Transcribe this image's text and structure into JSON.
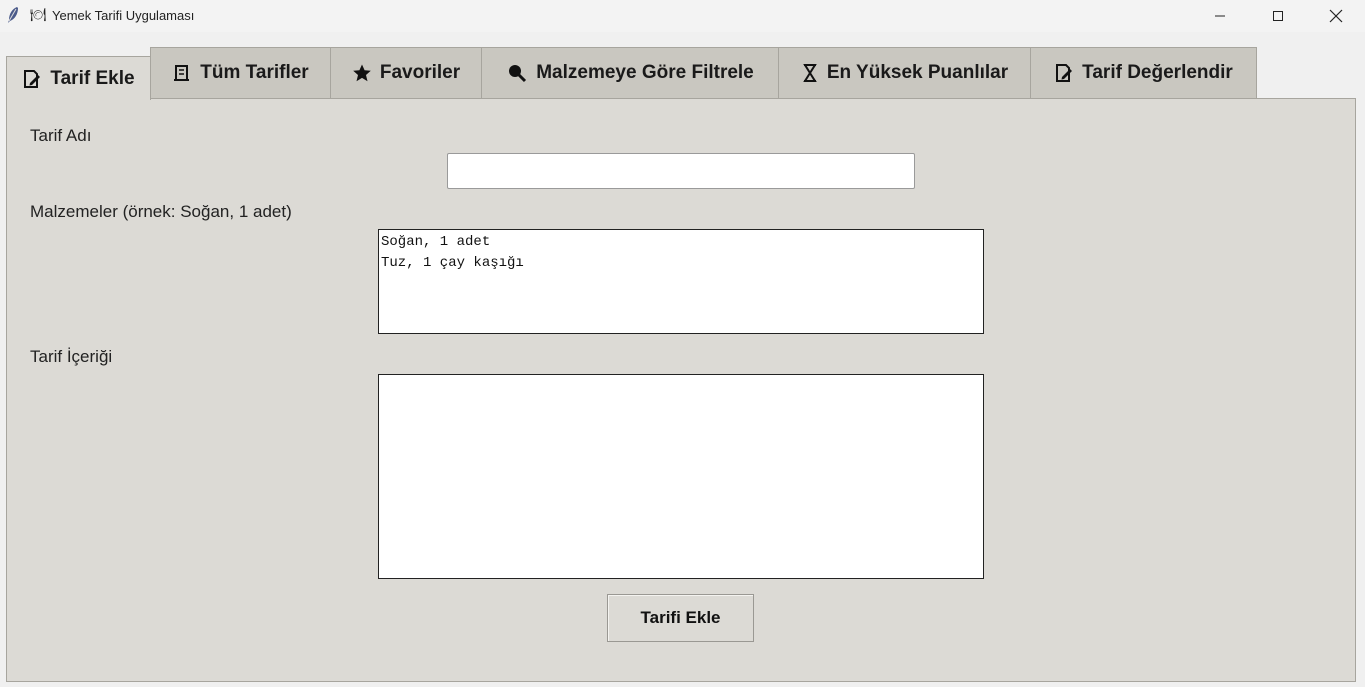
{
  "window": {
    "title_emoji": "🍽",
    "title": "Yemek Tarifi Uygulaması",
    "icons": {
      "app": "feather-icon",
      "minimize": "minimize-icon",
      "maximize": "maximize-icon",
      "close": "close-icon"
    }
  },
  "tabs": [
    {
      "label": "Tarif Ekle",
      "icon": "edit-document-icon",
      "active": true
    },
    {
      "label": "Tüm Tarifler",
      "icon": "scroll-icon",
      "active": false
    },
    {
      "label": "Favoriler",
      "icon": "star-icon",
      "active": false
    },
    {
      "label": "Malzemeye Göre Filtrele",
      "icon": "magnifier-icon",
      "active": false
    },
    {
      "label": "En Yüksek Puanlılar",
      "icon": "hourglass-icon",
      "active": false
    },
    {
      "label": "Tarif Değerlendir",
      "icon": "edit-document-icon",
      "active": false
    }
  ],
  "form": {
    "name_label": "Tarif Adı",
    "name_value": "",
    "ingredients_label": "Malzemeler (örnek: Soğan, 1 adet)",
    "ingredients_value": "Soğan, 1 adet\nTuz, 1 çay kaşığı",
    "content_label": "Tarif İçeriği",
    "content_value": "",
    "submit_label": "Tarifi Ekle"
  },
  "colors": {
    "panel": "#dcdad5",
    "tab_inactive": "#c9c7c0",
    "titlebar": "#f3f3f3"
  }
}
